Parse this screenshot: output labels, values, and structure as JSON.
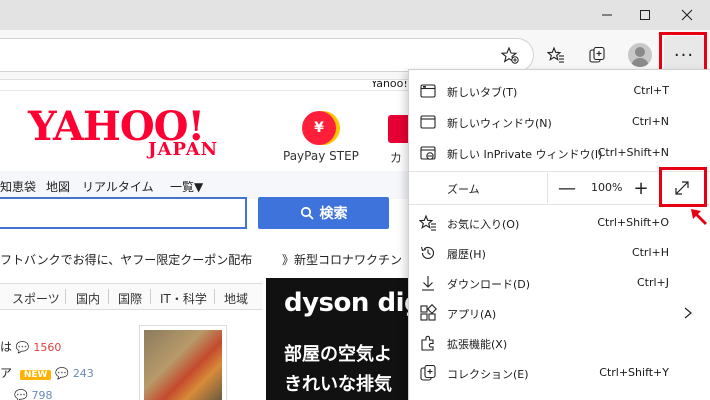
{
  "window": {
    "controls": [
      {
        "name": "minimize",
        "icon": "minimize-icon"
      },
      {
        "name": "maximize",
        "icon": "maximize-icon"
      },
      {
        "name": "close",
        "icon": "close-icon"
      }
    ]
  },
  "toolbar": {
    "icons": [
      "add-favorite-icon",
      "favorites-icon",
      "collections-icon",
      "profile-icon"
    ],
    "more_label": "···"
  },
  "yahoo": {
    "top_link": "Yahoo!",
    "logo": "YAHOO!",
    "logo_sub": "JAPAN",
    "paypay_icon_text": "¥",
    "paypay_label": "PayPay STEP",
    "card_label": "カー",
    "nav": [
      "知恵袋",
      "地図",
      "リアルタイム",
      "一覧▼"
    ],
    "search_button": "検索",
    "ticker_left": "フトバンクでお得に、ヤフー限定クーポン配布",
    "ticker_right": "》新型コロナワクチン",
    "topics": [
      "スポーツ",
      "国内",
      "国際",
      "IT・科学",
      "地域"
    ],
    "news": [
      {
        "text": "は",
        "comments": "1560"
      },
      {
        "text": "ア",
        "badge": "NEW",
        "comments": "243"
      },
      {
        "text": "",
        "comments": "798"
      }
    ],
    "ad": {
      "brand": "dyson digit",
      "line1": "部屋の空気よ",
      "line2": "きれいな排気"
    }
  },
  "menu": {
    "items_top": [
      {
        "label": "新しいタブ(T)",
        "shortcut": "Ctrl+T",
        "icon": "new-tab-icon"
      },
      {
        "label": "新しいウィンドウ(N)",
        "shortcut": "Ctrl+N",
        "icon": "new-window-icon"
      },
      {
        "label": "新しい InPrivate ウィンドウ(I)",
        "shortcut": "Ctrl+Shift+N",
        "icon": "inprivate-icon"
      }
    ],
    "zoom": {
      "label": "ズーム",
      "minus": "—",
      "value": "100%",
      "plus": "+"
    },
    "items_bottom": [
      {
        "label": "お気に入り(O)",
        "shortcut": "Ctrl+Shift+O",
        "icon": "favorites-icon"
      },
      {
        "label": "履歴(H)",
        "shortcut": "Ctrl+H",
        "icon": "history-icon"
      },
      {
        "label": "ダウンロード(D)",
        "shortcut": "Ctrl+J",
        "icon": "download-icon"
      },
      {
        "label": "アプリ(A)",
        "shortcut": "",
        "icon": "apps-icon"
      },
      {
        "label": "拡張機能(X)",
        "shortcut": "",
        "icon": "extensions-icon"
      },
      {
        "label": "コレクション(E)",
        "shortcut": "Ctrl+Shift+Y",
        "icon": "collections-icon"
      }
    ]
  },
  "colors": {
    "highlight": "#e60012",
    "yahoo_red": "#ff0033",
    "search_blue": "#3d73db"
  }
}
